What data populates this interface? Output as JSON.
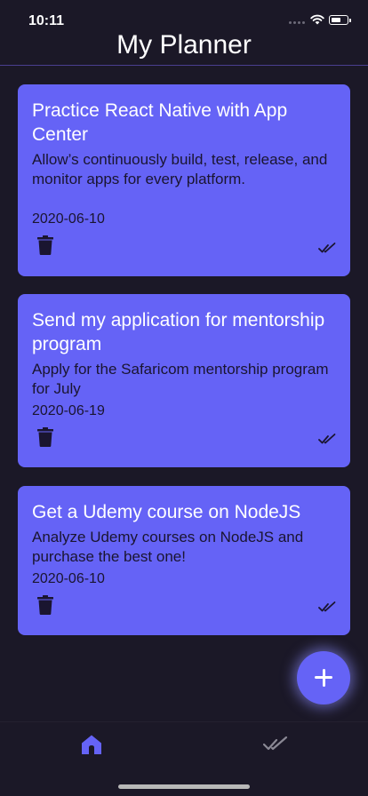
{
  "status_bar": {
    "time": "10:11"
  },
  "header": {
    "title": "My Planner"
  },
  "tasks": [
    {
      "title": "Practice React Native with App Center",
      "description": "Allow’s continuously build, test, release, and monitor apps for every platform.",
      "date": "2020-06-10"
    },
    {
      "title": "Send my application for mentorship program",
      "description": "Apply for the Safaricom mentorship program for July",
      "date": "2020-06-19"
    },
    {
      "title": "Get a Udemy course on NodeJS",
      "description": "Analyze Udemy courses on NodeJS and purchase the best one!",
      "date": "2020-06-10"
    }
  ],
  "icons": {
    "fab": "plus-icon",
    "tab_home": "home-icon",
    "tab_completed": "double-check-icon",
    "card_delete": "trash-icon",
    "card_complete": "double-check-icon"
  },
  "colors": {
    "background": "#1b1827",
    "card": "#6563f6",
    "accent": "#6563f6",
    "inactive_tab": "#8a8894"
  }
}
